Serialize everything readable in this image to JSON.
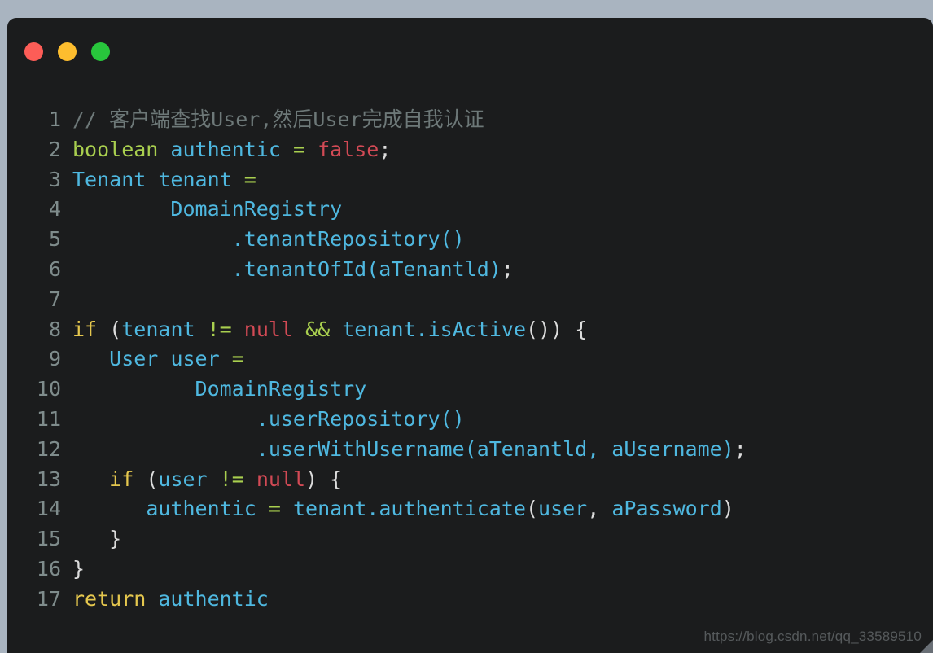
{
  "window": {
    "background_color": "#a9b4c0",
    "surface_color": "#1b1c1d",
    "traffic_lights": [
      {
        "name": "close",
        "color": "#fd5d57"
      },
      {
        "name": "minimize",
        "color": "#fdbd2e"
      },
      {
        "name": "maximize",
        "color": "#28c63c"
      }
    ]
  },
  "palette": {
    "comment": "#6d7878",
    "keyword": "#a9cf4f",
    "control": "#e5c74e",
    "identifier": "#4fb8e0",
    "literal": "#d24a55",
    "operator": "#a9cf4f",
    "punctuation": "#dcdcdc",
    "line_number": "#7f8c8c"
  },
  "editor": {
    "language": "java",
    "line_count": 17,
    "lines": [
      {
        "number": "1",
        "plain": "// 客户端查找User,然后User完成自我认证",
        "tokens": [
          {
            "t": "// 客户端查找User,然后User完成自我认证",
            "c": "comment"
          }
        ]
      },
      {
        "number": "2",
        "plain": "boolean authentic = false;",
        "tokens": [
          {
            "t": "boolean",
            "c": "keyword"
          },
          {
            "t": " ",
            "c": "plain"
          },
          {
            "t": "authentic",
            "c": "ident"
          },
          {
            "t": " ",
            "c": "plain"
          },
          {
            "t": "=",
            "c": "op"
          },
          {
            "t": " ",
            "c": "plain"
          },
          {
            "t": "false",
            "c": "literal"
          },
          {
            "t": ";",
            "c": "punct"
          }
        ]
      },
      {
        "number": "3",
        "plain": "Tenant tenant =",
        "tokens": [
          {
            "t": "Tenant",
            "c": "ident"
          },
          {
            "t": " ",
            "c": "plain"
          },
          {
            "t": "tenant",
            "c": "ident"
          },
          {
            "t": " ",
            "c": "plain"
          },
          {
            "t": "=",
            "c": "op"
          }
        ]
      },
      {
        "number": "4",
        "plain": "        DomainRegistry",
        "tokens": [
          {
            "t": "        ",
            "c": "plain"
          },
          {
            "t": "DomainRegistry",
            "c": "ident"
          }
        ]
      },
      {
        "number": "5",
        "plain": "             .tenantRepository()",
        "tokens": [
          {
            "t": "             ",
            "c": "plain"
          },
          {
            "t": ".tenantRepository()",
            "c": "ident"
          }
        ]
      },
      {
        "number": "6",
        "plain": "             .tenantOfId(aTenantld);",
        "tokens": [
          {
            "t": "             ",
            "c": "plain"
          },
          {
            "t": ".tenantOfId(aTenantld)",
            "c": "ident"
          },
          {
            "t": ";",
            "c": "punct"
          }
        ]
      },
      {
        "number": "7",
        "plain": "",
        "tokens": []
      },
      {
        "number": "8",
        "plain": "if (tenant != null && tenant.isActive()) {",
        "tokens": [
          {
            "t": "if",
            "c": "control"
          },
          {
            "t": " ",
            "c": "plain"
          },
          {
            "t": "(",
            "c": "punct"
          },
          {
            "t": "tenant",
            "c": "ident"
          },
          {
            "t": " ",
            "c": "plain"
          },
          {
            "t": "!=",
            "c": "op"
          },
          {
            "t": " ",
            "c": "plain"
          },
          {
            "t": "null",
            "c": "literal"
          },
          {
            "t": " ",
            "c": "plain"
          },
          {
            "t": "&&",
            "c": "op"
          },
          {
            "t": " ",
            "c": "plain"
          },
          {
            "t": "tenant.isActive",
            "c": "ident"
          },
          {
            "t": "()) {",
            "c": "punct"
          }
        ]
      },
      {
        "number": "9",
        "plain": "   User user =",
        "tokens": [
          {
            "t": "   ",
            "c": "plain"
          },
          {
            "t": "User",
            "c": "ident"
          },
          {
            "t": " ",
            "c": "plain"
          },
          {
            "t": "user",
            "c": "ident"
          },
          {
            "t": " ",
            "c": "plain"
          },
          {
            "t": "=",
            "c": "op"
          }
        ]
      },
      {
        "number": "10",
        "plain": "          DomainRegistry",
        "tokens": [
          {
            "t": "          ",
            "c": "plain"
          },
          {
            "t": "DomainRegistry",
            "c": "ident"
          }
        ]
      },
      {
        "number": "11",
        "plain": "               .userRepository()",
        "tokens": [
          {
            "t": "               ",
            "c": "plain"
          },
          {
            "t": ".userRepository()",
            "c": "ident"
          }
        ]
      },
      {
        "number": "12",
        "plain": "               .userWithUsername(aTenantld, aUsername);",
        "tokens": [
          {
            "t": "               ",
            "c": "plain"
          },
          {
            "t": ".userWithUsername(aTenantld, aUsername)",
            "c": "ident"
          },
          {
            "t": ";",
            "c": "punct"
          }
        ]
      },
      {
        "number": "13",
        "plain": "   if (user != null) {",
        "tokens": [
          {
            "t": "   ",
            "c": "plain"
          },
          {
            "t": "if",
            "c": "control"
          },
          {
            "t": " ",
            "c": "plain"
          },
          {
            "t": "(",
            "c": "punct"
          },
          {
            "t": "user",
            "c": "ident"
          },
          {
            "t": " ",
            "c": "plain"
          },
          {
            "t": "!=",
            "c": "op"
          },
          {
            "t": " ",
            "c": "plain"
          },
          {
            "t": "null",
            "c": "literal"
          },
          {
            "t": ") {",
            "c": "punct"
          }
        ]
      },
      {
        "number": "14",
        "plain": "      authentic = tenant.authenticate(user, aPassword)",
        "tokens": [
          {
            "t": "      ",
            "c": "plain"
          },
          {
            "t": "authentic",
            "c": "ident"
          },
          {
            "t": " ",
            "c": "plain"
          },
          {
            "t": "=",
            "c": "op"
          },
          {
            "t": " ",
            "c": "plain"
          },
          {
            "t": "tenant.authenticate",
            "c": "ident"
          },
          {
            "t": "(",
            "c": "punct"
          },
          {
            "t": "user",
            "c": "ident"
          },
          {
            "t": ", ",
            "c": "punct"
          },
          {
            "t": "aPassword",
            "c": "ident"
          },
          {
            "t": ")",
            "c": "punct"
          }
        ]
      },
      {
        "number": "15",
        "plain": "   }",
        "tokens": [
          {
            "t": "   ",
            "c": "plain"
          },
          {
            "t": "}",
            "c": "punct"
          }
        ]
      },
      {
        "number": "16",
        "plain": "}",
        "tokens": [
          {
            "t": "}",
            "c": "punct"
          }
        ]
      },
      {
        "number": "17",
        "plain": "return authentic",
        "tokens": [
          {
            "t": "return",
            "c": "control"
          },
          {
            "t": " ",
            "c": "plain"
          },
          {
            "t": "authentic",
            "c": "ident"
          }
        ]
      }
    ]
  },
  "watermark": {
    "text": "https://blog.csdn.net/qq_33589510"
  }
}
